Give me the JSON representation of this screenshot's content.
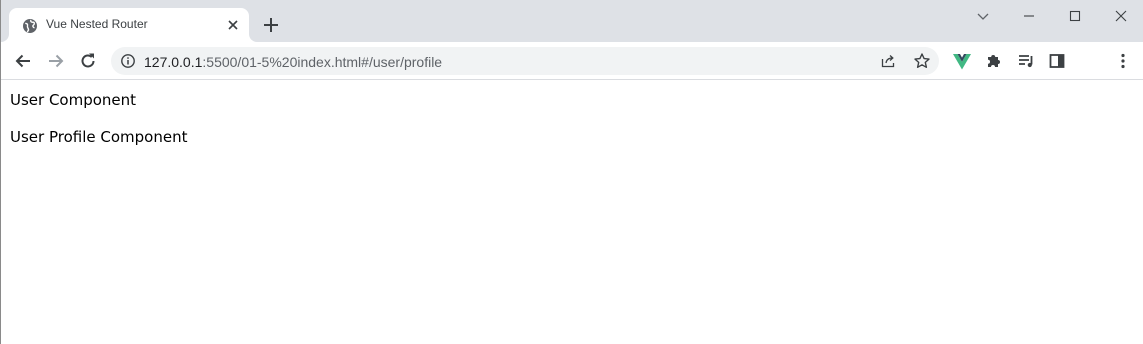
{
  "browser": {
    "tab": {
      "title": "Vue Nested Router"
    },
    "address_bar": {
      "url_host": "127.0.0.1",
      "url_rest": ":5500/01-5%20index.html#/user/profile"
    },
    "icons": {
      "favicon": "globe-icon",
      "tab_close": "close-icon",
      "new_tab": "plus-icon",
      "back": "back-arrow-icon",
      "forward": "forward-arrow-icon",
      "reload": "reload-icon",
      "info": "info-icon",
      "share": "share-icon",
      "bookmark": "star-icon",
      "vue_devtools": "vue-icon",
      "extensions": "puzzle-icon",
      "reading_list": "reading-list-icon",
      "side_panel": "side-panel-icon",
      "profile": "avatar-icon",
      "menu": "kebab-menu-icon"
    },
    "colors": {
      "tabstrip": "#dee1e6",
      "omnibox": "#f1f3f4",
      "vue_green": "#41b883",
      "vue_dark": "#34495e"
    }
  },
  "page": {
    "user_component": "User Component",
    "user_profile_component": "User Profile Component"
  }
}
